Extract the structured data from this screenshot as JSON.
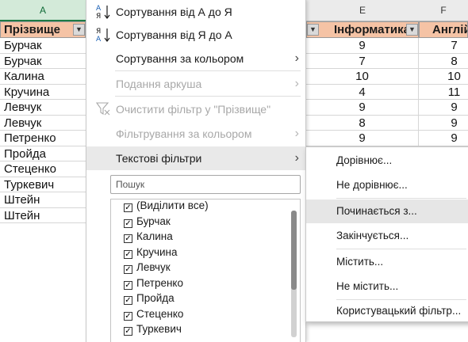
{
  "sheet": {
    "col_a": "A",
    "col_e": "E",
    "col_f": "F",
    "header_surname": "Прізвище",
    "header_informatics": "Інформатика",
    "header_english": "Англій",
    "surnames": [
      "Бурчак",
      "Бурчак",
      "Калина",
      "Кручина",
      "Левчук",
      "Левчук",
      "Петренко",
      "Пройда",
      "Стеценко",
      "Туркевич",
      "Штейн",
      "Штейн"
    ],
    "informatics": [
      "9",
      "7",
      "10",
      "4",
      "9",
      "8",
      "9"
    ],
    "english": [
      "7",
      "8",
      "10",
      "11",
      "9",
      "9",
      "9"
    ],
    "filter_arrow": "▼"
  },
  "menu": {
    "sort_az": "Сортування від А до Я",
    "sort_za": "Сортування від Я до А",
    "sort_color": "Сортування за кольором",
    "sheet_view": "Подання аркуша",
    "clear_filter": "Очистити фільтр у \"Прізвище\"",
    "filter_color": "Фільтрування за кольором",
    "text_filters": "Текстові фільтри",
    "search_placeholder": "Пошук",
    "list_items": [
      "(Виділити все)",
      "Бурчак",
      "Калина",
      "Кручина",
      "Левчук",
      "Петренко",
      "Пройда",
      "Стеценко",
      "Туркевич"
    ]
  },
  "submenu": {
    "items": [
      "Дорівнює...",
      "Не дорівнює...",
      "Починається з...",
      "Закінчується...",
      "Містить...",
      "Не містить...",
      "Користувацький фільтр..."
    ]
  }
}
